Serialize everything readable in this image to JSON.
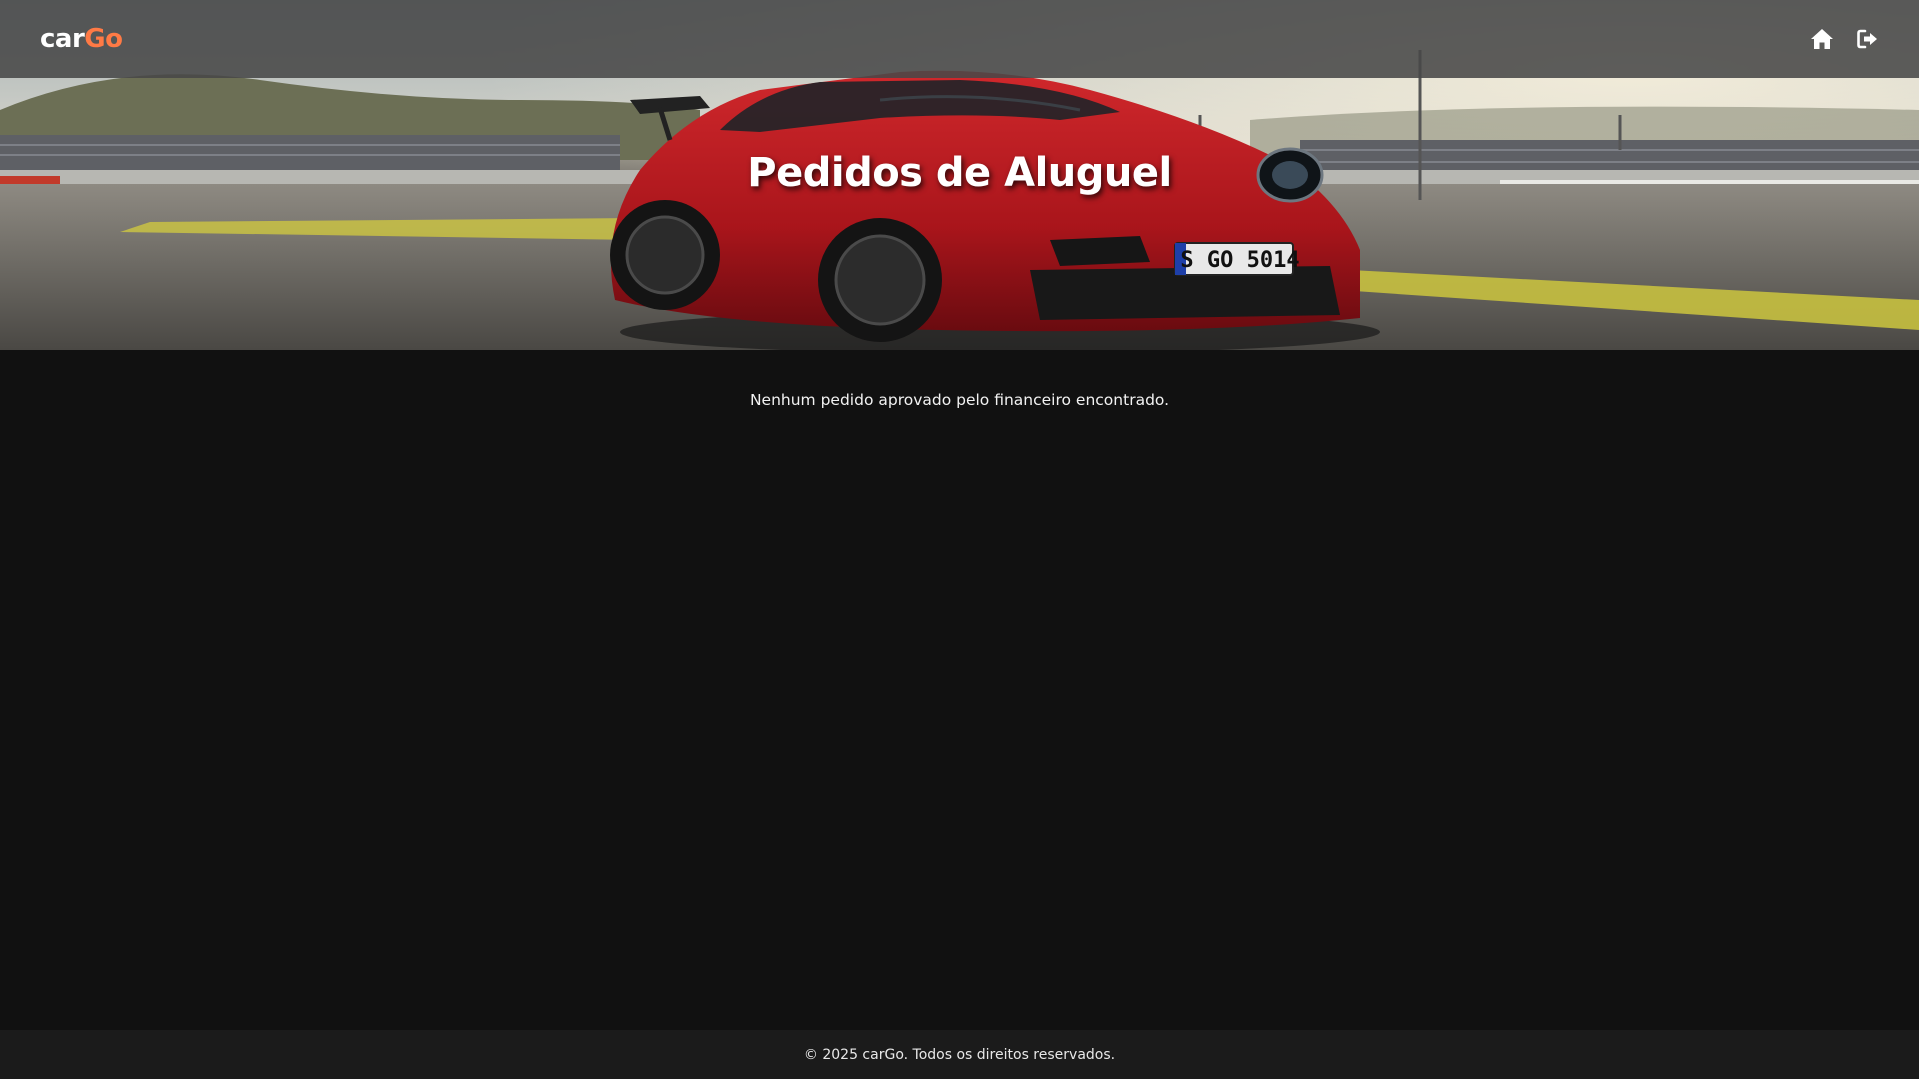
{
  "navbar": {
    "brand_part1": "car",
    "brand_part2": "Go",
    "brand_accent_color": "#ff7a45",
    "icons": [
      "home-icon",
      "logout-icon"
    ]
  },
  "hero": {
    "title": "Pedidos de Aluguel",
    "plate_text": "S GO 5014"
  },
  "main": {
    "empty_message": "Nenhum pedido aprovado pelo financeiro encontrado."
  },
  "footer": {
    "copyright": "© 2025 carGo. Todos os direitos reservados."
  }
}
